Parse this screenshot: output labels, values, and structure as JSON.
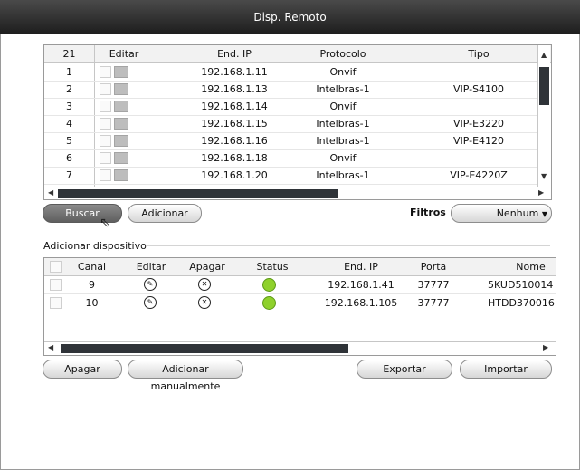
{
  "window": {
    "title": "Disp. Remoto"
  },
  "remote_table": {
    "count_header": "21",
    "columns": [
      "Editar",
      "End. IP",
      "Protocolo",
      "Tipo"
    ],
    "rows": [
      {
        "n": "1",
        "ip": "192.168.1.11",
        "protocol": "Onvif",
        "type": ""
      },
      {
        "n": "2",
        "ip": "192.168.1.13",
        "protocol": "Intelbras-1",
        "type": "VIP-S4100"
      },
      {
        "n": "3",
        "ip": "192.168.1.14",
        "protocol": "Onvif",
        "type": ""
      },
      {
        "n": "4",
        "ip": "192.168.1.15",
        "protocol": "Intelbras-1",
        "type": "VIP-E3220"
      },
      {
        "n": "5",
        "ip": "192.168.1.16",
        "protocol": "Intelbras-1",
        "type": "VIP-E4120"
      },
      {
        "n": "6",
        "ip": "192.168.1.18",
        "protocol": "Onvif",
        "type": ""
      },
      {
        "n": "7",
        "ip": "192.168.1.20",
        "protocol": "Intelbras-1",
        "type": "VIP-E4220Z"
      }
    ]
  },
  "search_row": {
    "search_label": "Buscar",
    "add_label": "Adicionar",
    "filters_label": "Filtros",
    "filter_value": "Nenhum"
  },
  "section": {
    "title": "Adicionar dispositivo"
  },
  "added_table": {
    "columns": [
      "Canal",
      "Editar",
      "Apagar",
      "Status",
      "End. IP",
      "Porta",
      "Nome"
    ],
    "rows": [
      {
        "canal": "9",
        "ip": "192.168.1.41",
        "port": "37777",
        "name": "5KUD510014"
      },
      {
        "canal": "10",
        "ip": "192.168.1.105",
        "port": "37777",
        "name": "HTDD370016"
      }
    ],
    "status_color": "#8fd12c"
  },
  "bottom_buttons": {
    "delete_label": "Apagar",
    "add_manual_label": "Adicionar manualmente",
    "export_label": "Exportar",
    "import_label": "Importar"
  }
}
